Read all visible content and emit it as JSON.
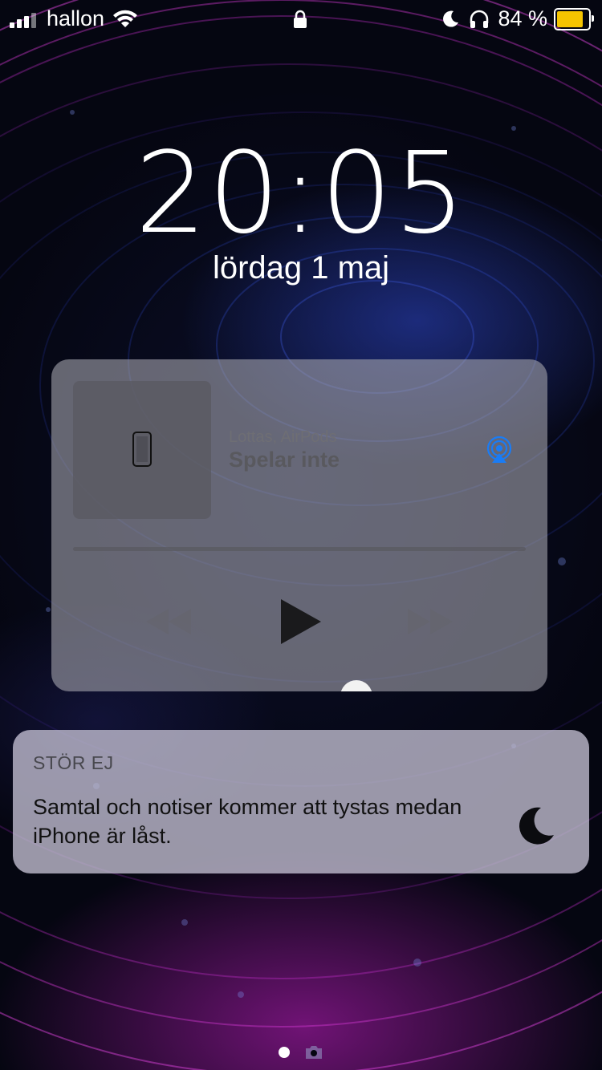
{
  "status_bar": {
    "carrier": "hallon",
    "battery_percent": "84 %",
    "battery_level": 0.84,
    "battery_color": "#f5c400",
    "icons": [
      "signal-icon",
      "wifi-icon",
      "lock-icon",
      "moon-icon",
      "headphones-icon",
      "battery-icon"
    ]
  },
  "lock_screen": {
    "time": "20:05",
    "date": "lördag 1 maj"
  },
  "media_player": {
    "subtitle": "Lottas, AirPods",
    "title": "Spelar inte",
    "artwork_icon": "iphone-icon",
    "airplay_color": "#1a7cf5",
    "controls": [
      "rewind-icon",
      "play-icon",
      "fast-forward-icon"
    ]
  },
  "notification": {
    "app": "STÖR EJ",
    "body": "Samtal och notiser kommer att tystas medan iPhone är låst.",
    "icon": "moon-icon"
  },
  "page_indicator": {
    "icons": [
      "page-dot-icon",
      "camera-icon"
    ]
  }
}
